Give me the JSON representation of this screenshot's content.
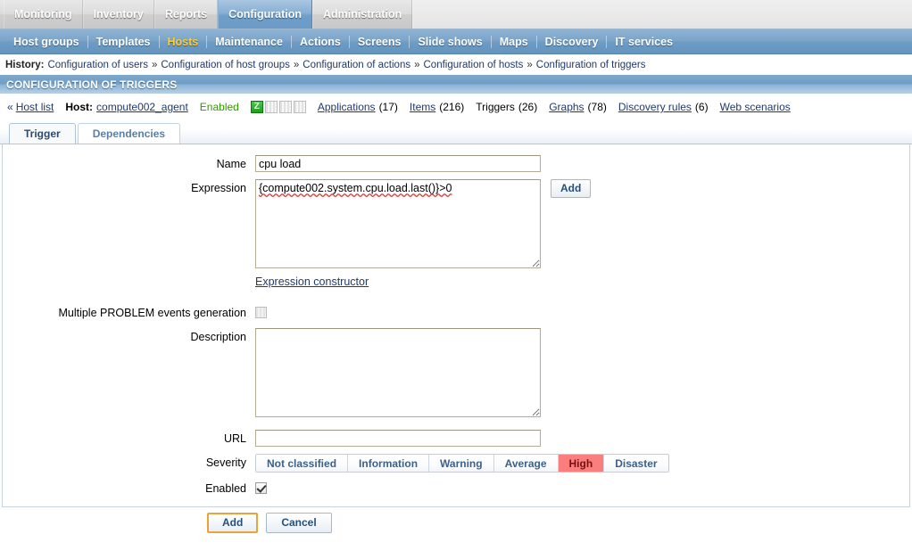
{
  "topnav": {
    "items": [
      {
        "label": "Monitoring",
        "selected": false
      },
      {
        "label": "Inventory",
        "selected": false
      },
      {
        "label": "Reports",
        "selected": false
      },
      {
        "label": "Configuration",
        "selected": true
      },
      {
        "label": "Administration",
        "selected": false
      }
    ]
  },
  "subnav": {
    "items": [
      {
        "label": "Host groups",
        "active": false
      },
      {
        "label": "Templates",
        "active": false
      },
      {
        "label": "Hosts",
        "active": true
      },
      {
        "label": "Maintenance",
        "active": false
      },
      {
        "label": "Actions",
        "active": false
      },
      {
        "label": "Screens",
        "active": false
      },
      {
        "label": "Slide shows",
        "active": false
      },
      {
        "label": "Maps",
        "active": false
      },
      {
        "label": "Discovery",
        "active": false
      },
      {
        "label": "IT services",
        "active": false
      }
    ]
  },
  "history": {
    "label": "History:",
    "separator": "»",
    "items": [
      "Configuration of users",
      "Configuration of host groups",
      "Configuration of actions",
      "Configuration of hosts",
      "Configuration of triggers"
    ]
  },
  "page_title": "CONFIGURATION OF TRIGGERS",
  "hostbar": {
    "back_chevron": "«",
    "host_list_label": "Host list",
    "host_label": "Host:",
    "host_name": "compute002_agent",
    "status": "Enabled",
    "availability_icons": [
      {
        "name": "zbx-availability-icon",
        "text": "Z",
        "state": "on"
      },
      {
        "name": "snmp-availability-icon",
        "text": "",
        "state": "off"
      },
      {
        "name": "jmx-availability-icon",
        "text": "",
        "state": "off"
      },
      {
        "name": "ipmi-availability-icon",
        "text": "",
        "state": "off"
      }
    ],
    "links": [
      {
        "label": "Applications",
        "count": "(17)",
        "is_link": true
      },
      {
        "label": "Items",
        "count": "(216)",
        "is_link": true
      },
      {
        "label": "Triggers",
        "count": "(26)",
        "is_link": false
      },
      {
        "label": "Graphs",
        "count": "(78)",
        "is_link": true
      },
      {
        "label": "Discovery rules",
        "count": "(6)",
        "is_link": true
      },
      {
        "label": "Web scenarios",
        "count": "",
        "is_link": true
      }
    ]
  },
  "tabs": [
    {
      "label": "Trigger",
      "active": true
    },
    {
      "label": "Dependencies",
      "active": false
    }
  ],
  "form": {
    "name_label": "Name",
    "name_value": "cpu load",
    "expression_label": "Expression",
    "expression_value": "{compute002.system.cpu.load.last()}>0",
    "expression_add_button": "Add",
    "expression_constructor_link": "Expression constructor",
    "multiple_problem_label": "Multiple PROBLEM events generation",
    "multiple_problem_checked": false,
    "description_label": "Description",
    "description_value": "",
    "url_label": "URL",
    "url_value": "",
    "severity_label": "Severity",
    "severity_options": [
      "Not classified",
      "Information",
      "Warning",
      "Average",
      "High",
      "Disaster"
    ],
    "severity_selected": "High",
    "enabled_label": "Enabled",
    "enabled_checked": true
  },
  "footer": {
    "add_label": "Add",
    "cancel_label": "Cancel"
  }
}
